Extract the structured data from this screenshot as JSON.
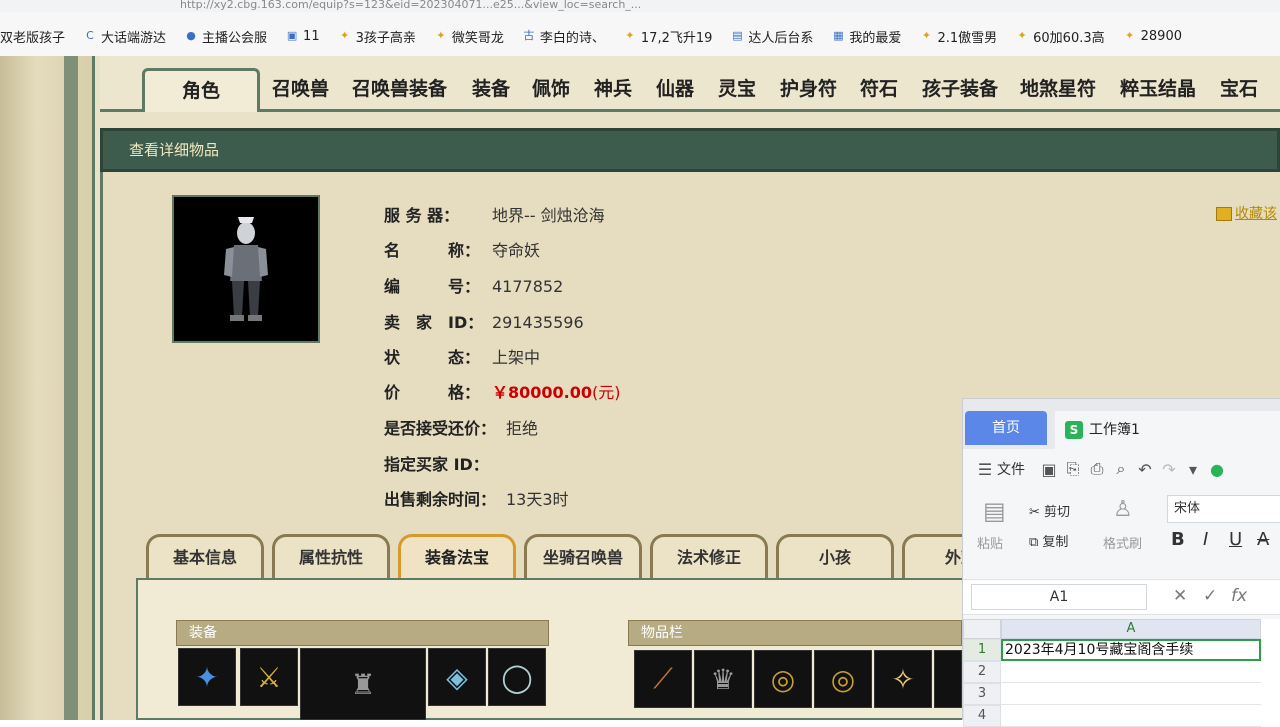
{
  "browser": {
    "url_partial": "http://xy2.cbg.163.com/equip?s=123&eid=202304071...e25...&view_loc=search_...",
    "bookmarks": [
      {
        "label": "双老版孩子",
        "icon": ""
      },
      {
        "label": "大话端游达",
        "icon": "C"
      },
      {
        "label": "主播公会服",
        "icon": "●"
      },
      {
        "label": "11",
        "icon": "▣"
      },
      {
        "label": "3孩子高亲",
        "icon": "✦"
      },
      {
        "label": "微笑哥龙",
        "icon": "✦"
      },
      {
        "label": "李白的诗、",
        "icon": "古"
      },
      {
        "label": "17,2飞升19",
        "icon": "✦"
      },
      {
        "label": "达人后台系",
        "icon": "▤"
      },
      {
        "label": "我的最爱",
        "icon": "▦"
      },
      {
        "label": "2.1傲雪男",
        "icon": "✦"
      },
      {
        "label": "60加60.3高",
        "icon": "✦"
      },
      {
        "label": "28900",
        "icon": "✦"
      }
    ]
  },
  "top_tabs": [
    "角色",
    "召唤兽",
    "召唤兽装备",
    "装备",
    "佩饰",
    "神兵",
    "仙器",
    "灵宝",
    "护身符",
    "符石",
    "孩子装备",
    "地煞星符",
    "粹玉结晶",
    "宝石"
  ],
  "panel": {
    "title": "查看详细物品",
    "favorite": "收藏该"
  },
  "info": {
    "server_label": "服 务 器：",
    "server_value": "地界-- 剑烛沧海",
    "name_label": "名　　　称：",
    "name_value": "夺命妖",
    "id_label": "编　　　号：",
    "id_value": "4177852",
    "seller_label": "卖　家　ID：",
    "seller_value": "291435596",
    "status_label": "状　　　态：",
    "status_value": "上架中",
    "price_label": "价　　　格：",
    "price_value": "￥80000.00",
    "price_unit": "(元)",
    "bargain_label": "是否接受还价：",
    "bargain_value": "拒绝",
    "buyer_label": "指定买家 ID：",
    "buyer_value": "",
    "remain_label": "出售剩余时间：",
    "remain_value": "13天3时"
  },
  "sub_tabs": [
    "基本信息",
    "属性抗性",
    "装备法宝",
    "坐骑召唤兽",
    "法术修正",
    "小孩",
    "外观"
  ],
  "sections": {
    "equip": "装备",
    "inventory": "物品栏"
  },
  "wps": {
    "home_tab": "首页",
    "doc_tab": "工作簿1",
    "doc_icon": "S",
    "menu_file": "文件",
    "cut": "剪切",
    "copy": "复制",
    "paste": "粘贴",
    "format_painter": "格式刷",
    "font_name": "宋体",
    "name_box": "A1",
    "col_a": "A",
    "rows": [
      "1",
      "2",
      "3",
      "4"
    ],
    "cell_a1": "2023年4月10号藏宝阁含手续"
  }
}
